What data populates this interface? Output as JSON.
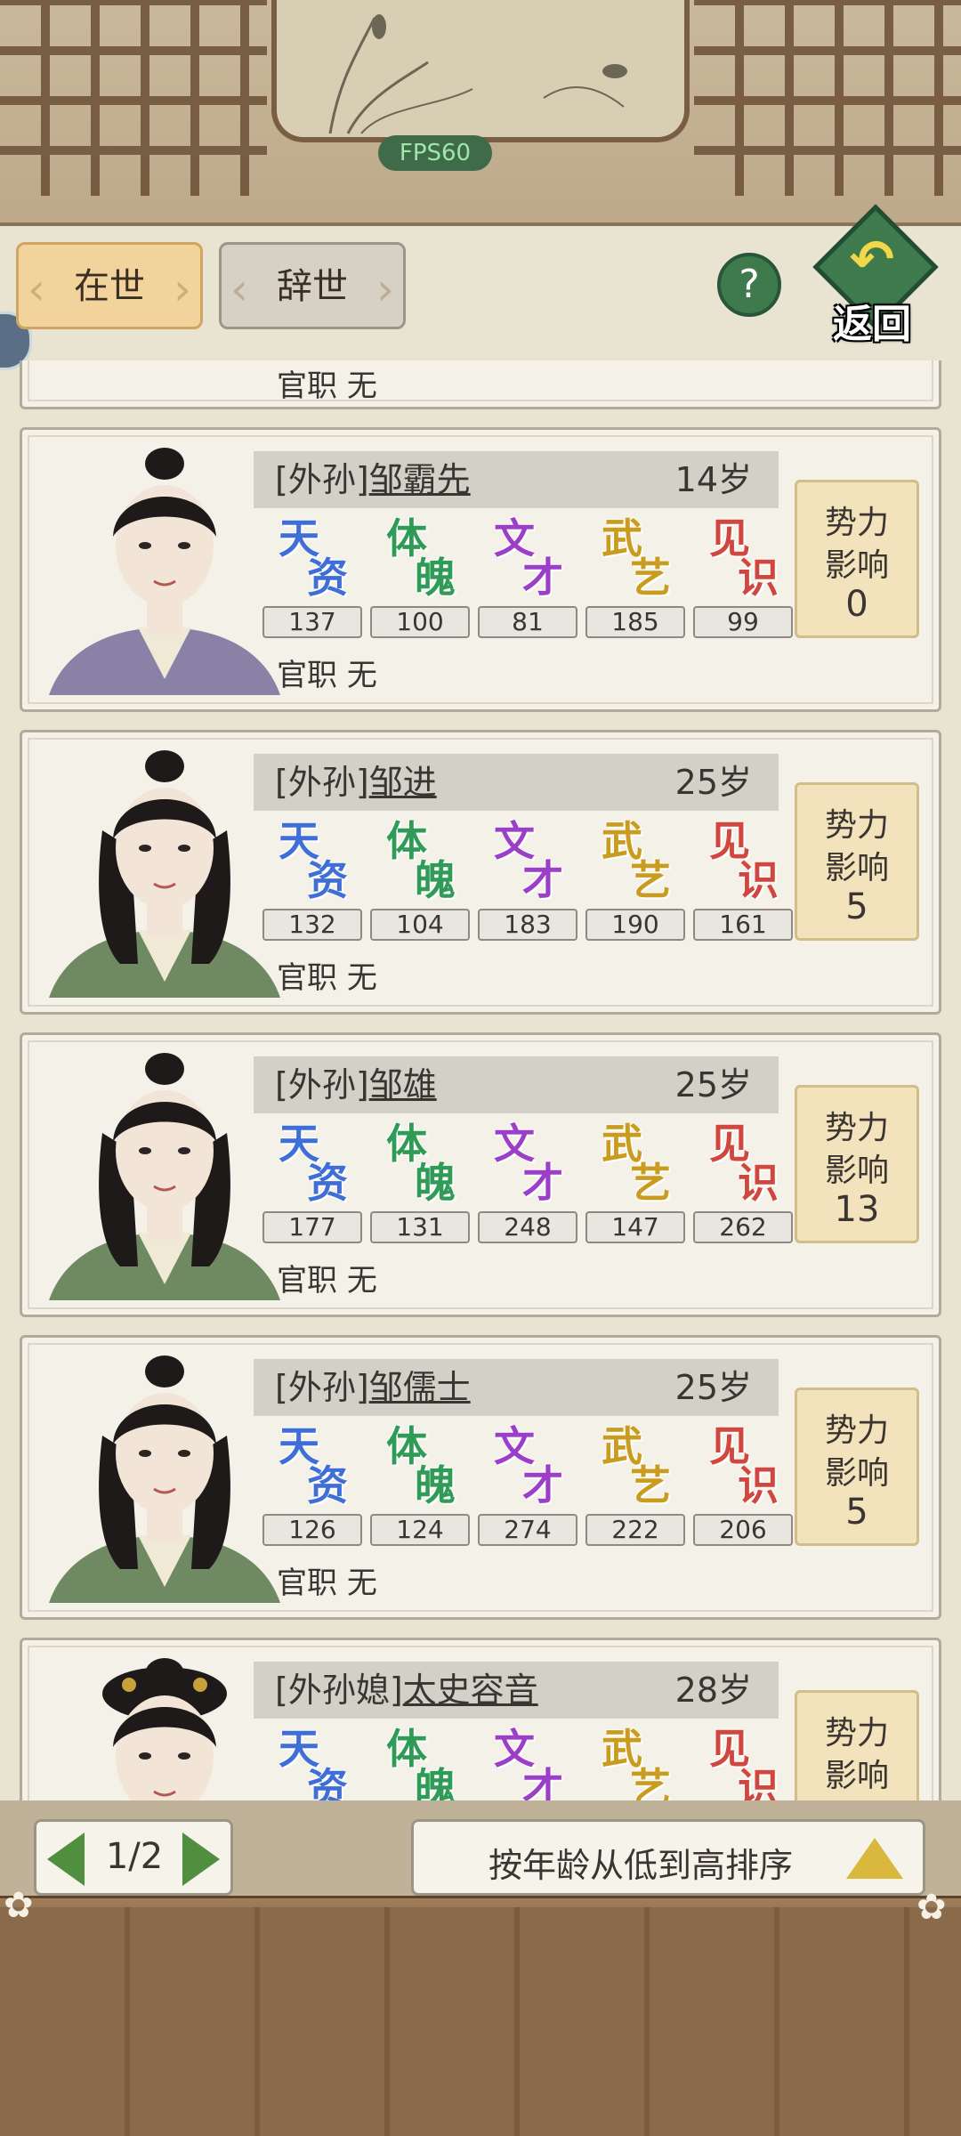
{
  "header": {
    "fps": "FPS60"
  },
  "tabs": [
    {
      "label": "在世",
      "active": true
    },
    {
      "label": "辞世",
      "active": false
    }
  ],
  "help_label": "?",
  "back_label": "返回",
  "partial_top_card": {
    "office_label": "官职",
    "office_value": "无"
  },
  "stat_glyphs": [
    {
      "top": "天",
      "bottom": "资",
      "color": "#3f6fd6"
    },
    {
      "top": "体",
      "bottom": "魄",
      "color": "#2f9b57"
    },
    {
      "top": "文",
      "bottom": "才",
      "color": "#9b3fc8"
    },
    {
      "top": "武",
      "bottom": "艺",
      "color": "#c99b1f"
    },
    {
      "top": "见",
      "bottom": "识",
      "color": "#d0473f"
    }
  ],
  "influence_label": [
    "势力",
    "影响"
  ],
  "members": [
    {
      "relation": "[外孙]",
      "name": "邹霸先",
      "age": "14岁",
      "stats": [
        "137",
        "100",
        "81",
        "185",
        "99"
      ],
      "office_label": "官职",
      "office_value": "无",
      "influence": "0",
      "portrait": "young-man",
      "robe": "#8a82a6"
    },
    {
      "relation": "[外孙]",
      "name": "邹进",
      "age": "25岁",
      "stats": [
        "132",
        "104",
        "183",
        "190",
        "161"
      ],
      "office_label": "官职",
      "office_value": "无",
      "influence": "5",
      "portrait": "long-hair-man",
      "robe": "#6f8a62"
    },
    {
      "relation": "[外孙]",
      "name": "邹雄",
      "age": "25岁",
      "stats": [
        "177",
        "131",
        "248",
        "147",
        "262"
      ],
      "office_label": "官职",
      "office_value": "无",
      "influence": "13",
      "portrait": "long-hair-man",
      "robe": "#6f8a62"
    },
    {
      "relation": "[外孙]",
      "name": "邹儒士",
      "age": "25岁",
      "stats": [
        "126",
        "124",
        "274",
        "222",
        "206"
      ],
      "office_label": "官职",
      "office_value": "无",
      "influence": "5",
      "portrait": "long-hair-man",
      "robe": "#6f8a62"
    },
    {
      "relation": "[外孙媳]",
      "name": "太史容音",
      "age": "28岁",
      "stats": [],
      "office_label": "",
      "office_value": "",
      "influence": "",
      "portrait": "woman",
      "robe": "#c3a6a6"
    }
  ],
  "pager": {
    "text": "1/2"
  },
  "sort": {
    "label": "按年龄从低到高排序"
  },
  "colors": {
    "accent_green": "#3e7a4c",
    "tab_active": "#f2d39b",
    "wood": "#8a6a4b"
  }
}
